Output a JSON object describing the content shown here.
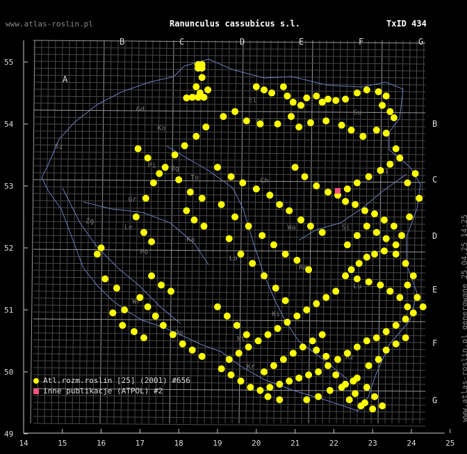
{
  "header": {
    "site": "www.atlas-roslin.pl",
    "species": "Ranunculus cassubicus s.l.",
    "txid": "TxID 434"
  },
  "side_note": "www.atlas-roslin.pl generowane 25.04.25 14:25",
  "legend": [
    {
      "label": "Atl.rozm.roslin [25] (2001) #656",
      "color": "#ffff00",
      "shape": "circle"
    },
    {
      "label": "inne publikacje (ATPOL) #2",
      "color": "#ff4f81",
      "shape": "square"
    }
  ],
  "axes": {
    "x_ticks": [
      "14",
      "15",
      "16",
      "17",
      "18",
      "19",
      "20",
      "21",
      "22",
      "23",
      "24",
      "25"
    ],
    "y_ticks": [
      "55",
      "54",
      "53",
      "52",
      "51",
      "50",
      "49"
    ]
  },
  "atpol_columns": [
    "A",
    "B",
    "C",
    "D",
    "E",
    "F",
    "G"
  ],
  "atpol_rows": [
    "B",
    "C",
    "D",
    "E",
    "F",
    "G"
  ],
  "region_labels": [
    "Gd",
    "Sl",
    "Ko",
    "Ol",
    "El",
    "Su",
    "Bi",
    "Sz",
    "Pi",
    "To",
    "Zg",
    "Le",
    "Po",
    "Ka",
    "Wa",
    "Lu",
    "Wr",
    "Op",
    "Ki",
    "Kr",
    "Rz",
    "Ra",
    "Si",
    "Lo",
    "Ch",
    "Bg",
    "Nt",
    "Gr"
  ],
  "map_data": {
    "atlas_records": [
      [
        18.5,
        54.96
      ],
      [
        18.6,
        54.96
      ],
      [
        18.5,
        54.9
      ],
      [
        18.6,
        54.9
      ],
      [
        18.6,
        54.75
      ],
      [
        18.45,
        54.6
      ],
      [
        18.75,
        54.55
      ],
      [
        18.55,
        54.5
      ],
      [
        18.65,
        54.43
      ],
      [
        18.35,
        54.43
      ],
      [
        18.5,
        54.43
      ],
      [
        18.2,
        54.42
      ],
      [
        20.0,
        54.6
      ],
      [
        20.2,
        54.55
      ],
      [
        20.4,
        54.5
      ],
      [
        20.7,
        54.6
      ],
      [
        20.8,
        54.45
      ],
      [
        20.95,
        54.35
      ],
      [
        21.15,
        54.3
      ],
      [
        21.3,
        54.42
      ],
      [
        21.55,
        54.45
      ],
      [
        21.7,
        54.35
      ],
      [
        21.85,
        54.4
      ],
      [
        22.05,
        54.38
      ],
      [
        22.3,
        54.4
      ],
      [
        22.6,
        54.5
      ],
      [
        22.85,
        54.55
      ],
      [
        23.15,
        54.52
      ],
      [
        23.35,
        54.45
      ],
      [
        23.25,
        54.3
      ],
      [
        23.45,
        54.2
      ],
      [
        23.55,
        54.1
      ],
      [
        19.15,
        54.12
      ],
      [
        19.45,
        54.2
      ],
      [
        19.75,
        54.05
      ],
      [
        20.1,
        54.0
      ],
      [
        20.55,
        54.0
      ],
      [
        20.9,
        54.12
      ],
      [
        21.1,
        53.95
      ],
      [
        21.4,
        54.02
      ],
      [
        21.8,
        54.05
      ],
      [
        22.2,
        53.98
      ],
      [
        22.45,
        53.9
      ],
      [
        22.75,
        53.8
      ],
      [
        23.1,
        53.9
      ],
      [
        23.35,
        53.85
      ],
      [
        23.6,
        53.6
      ],
      [
        23.7,
        53.45
      ],
      [
        23.45,
        53.35
      ],
      [
        23.2,
        53.25
      ],
      [
        22.9,
        53.15
      ],
      [
        22.6,
        53.05
      ],
      [
        22.35,
        52.95
      ],
      [
        22.1,
        52.85
      ],
      [
        22.3,
        52.75
      ],
      [
        22.55,
        52.7
      ],
      [
        22.8,
        52.6
      ],
      [
        23.05,
        52.55
      ],
      [
        23.3,
        52.45
      ],
      [
        23.55,
        52.35
      ],
      [
        23.75,
        52.2
      ],
      [
        23.6,
        52.05
      ],
      [
        23.3,
        51.95
      ],
      [
        23.05,
        51.9
      ],
      [
        22.85,
        51.85
      ],
      [
        22.65,
        51.75
      ],
      [
        22.45,
        51.65
      ],
      [
        22.3,
        51.55
      ],
      [
        22.6,
        51.5
      ],
      [
        22.9,
        51.45
      ],
      [
        23.2,
        51.4
      ],
      [
        23.45,
        51.3
      ],
      [
        23.7,
        51.2
      ],
      [
        23.9,
        51.05
      ],
      [
        24.05,
        50.95
      ],
      [
        23.85,
        50.85
      ],
      [
        23.6,
        50.75
      ],
      [
        23.35,
        50.65
      ],
      [
        23.1,
        50.55
      ],
      [
        22.85,
        50.5
      ],
      [
        22.6,
        50.4
      ],
      [
        22.35,
        50.3
      ],
      [
        22.1,
        50.2
      ],
      [
        21.85,
        50.1
      ],
      [
        21.6,
        50.0
      ],
      [
        21.35,
        49.95
      ],
      [
        21.1,
        49.9
      ],
      [
        20.85,
        49.85
      ],
      [
        20.6,
        49.8
      ],
      [
        20.35,
        49.75
      ],
      [
        20.1,
        49.7
      ],
      [
        19.85,
        49.75
      ],
      [
        19.6,
        49.85
      ],
      [
        19.35,
        49.95
      ],
      [
        19.1,
        50.05
      ],
      [
        19.3,
        50.2
      ],
      [
        19.55,
        50.3
      ],
      [
        19.8,
        50.4
      ],
      [
        20.05,
        50.5
      ],
      [
        20.3,
        50.6
      ],
      [
        20.55,
        50.7
      ],
      [
        20.8,
        50.8
      ],
      [
        21.05,
        50.9
      ],
      [
        21.3,
        51.0
      ],
      [
        21.55,
        51.1
      ],
      [
        21.8,
        51.2
      ],
      [
        22.05,
        51.3
      ],
      [
        21.7,
        50.6
      ],
      [
        21.45,
        50.5
      ],
      [
        21.2,
        50.4
      ],
      [
        20.95,
        50.3
      ],
      [
        20.7,
        50.2
      ],
      [
        20.45,
        50.1
      ],
      [
        20.2,
        50.0
      ],
      [
        22.6,
        49.9
      ],
      [
        22.85,
        49.75
      ],
      [
        23.05,
        49.6
      ],
      [
        22.8,
        49.5
      ],
      [
        22.55,
        49.65
      ],
      [
        22.3,
        49.8
      ],
      [
        22.05,
        49.95
      ],
      [
        21.8,
        50.25
      ],
      [
        21.55,
        50.35
      ],
      [
        22.9,
        50.1
      ],
      [
        23.15,
        50.2
      ],
      [
        23.35,
        50.35
      ],
      [
        23.6,
        50.45
      ],
      [
        23.85,
        50.55
      ],
      [
        17.0,
        51.2
      ],
      [
        17.2,
        51.05
      ],
      [
        17.4,
        50.9
      ],
      [
        17.6,
        50.75
      ],
      [
        17.85,
        50.6
      ],
      [
        18.1,
        50.45
      ],
      [
        18.35,
        50.35
      ],
      [
        18.6,
        50.25
      ],
      [
        17.3,
        51.55
      ],
      [
        17.55,
        51.4
      ],
      [
        17.8,
        51.3
      ],
      [
        16.6,
        51.0
      ],
      [
        16.4,
        51.35
      ],
      [
        16.1,
        51.5
      ],
      [
        16.0,
        52.0
      ],
      [
        18.2,
        52.6
      ],
      [
        18.4,
        52.45
      ],
      [
        18.65,
        52.35
      ],
      [
        19.3,
        52.15
      ],
      [
        19.6,
        51.9
      ],
      [
        19.9,
        51.75
      ],
      [
        20.2,
        51.55
      ],
      [
        20.5,
        51.35
      ],
      [
        20.75,
        51.15
      ],
      [
        19.1,
        52.7
      ],
      [
        19.45,
        52.5
      ],
      [
        19.8,
        52.35
      ],
      [
        20.15,
        52.2
      ],
      [
        20.45,
        52.05
      ],
      [
        20.75,
        51.9
      ],
      [
        21.05,
        51.8
      ],
      [
        21.35,
        51.65
      ],
      [
        17.3,
        52.1
      ],
      [
        17.1,
        52.25
      ],
      [
        16.9,
        52.5
      ],
      [
        17.15,
        52.8
      ],
      [
        17.35,
        53.05
      ],
      [
        17.65,
        53.3
      ],
      [
        17.9,
        53.5
      ],
      [
        18.15,
        53.65
      ],
      [
        18.45,
        53.8
      ],
      [
        18.7,
        53.95
      ],
      [
        19.0,
        53.3
      ],
      [
        19.35,
        53.15
      ],
      [
        19.65,
        53.05
      ],
      [
        20.0,
        52.95
      ],
      [
        20.35,
        52.85
      ],
      [
        20.6,
        52.7
      ],
      [
        20.85,
        52.6
      ],
      [
        21.15,
        52.45
      ],
      [
        21.4,
        52.35
      ],
      [
        21.7,
        52.25
      ],
      [
        16.95,
        53.6
      ],
      [
        17.2,
        53.45
      ],
      [
        17.5,
        53.2
      ],
      [
        18.0,
        53.1
      ],
      [
        18.3,
        52.9
      ],
      [
        18.6,
        52.8
      ],
      [
        21.0,
        53.3
      ],
      [
        21.25,
        53.15
      ],
      [
        21.55,
        53.0
      ],
      [
        21.85,
        52.9
      ],
      [
        15.9,
        51.9
      ],
      [
        16.3,
        50.95
      ],
      [
        16.55,
        50.75
      ],
      [
        16.85,
        50.65
      ],
      [
        17.1,
        50.55
      ],
      [
        21.3,
        49.55
      ],
      [
        21.6,
        49.6
      ],
      [
        21.9,
        49.7
      ],
      [
        22.2,
        49.75
      ],
      [
        22.5,
        49.85
      ],
      [
        23.0,
        49.4
      ],
      [
        23.25,
        49.45
      ],
      [
        22.7,
        49.45
      ],
      [
        22.4,
        49.55
      ],
      [
        20.3,
        49.6
      ],
      [
        20.6,
        49.55
      ],
      [
        19.75,
        50.6
      ],
      [
        19.5,
        50.75
      ],
      [
        19.25,
        50.9
      ],
      [
        19.0,
        51.05
      ],
      [
        22.35,
        52.05
      ],
      [
        22.6,
        52.2
      ],
      [
        22.85,
        52.35
      ],
      [
        23.1,
        52.25
      ],
      [
        23.35,
        52.15
      ],
      [
        23.6,
        51.9
      ],
      [
        23.85,
        51.75
      ],
      [
        24.05,
        51.55
      ],
      [
        23.9,
        51.4
      ],
      [
        24.15,
        51.2
      ],
      [
        24.3,
        51.05
      ],
      [
        23.95,
        52.5
      ],
      [
        24.2,
        52.8
      ],
      [
        23.9,
        53.05
      ],
      [
        24.1,
        53.2
      ]
    ],
    "other_records": [
      [
        22.1,
        52.92
      ]
    ]
  }
}
